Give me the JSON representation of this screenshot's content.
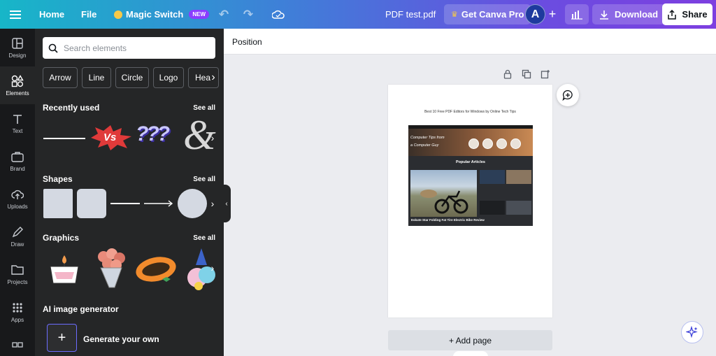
{
  "topbar": {
    "home": "Home",
    "file": "File",
    "magic_switch": "Magic Switch",
    "new_badge": "NEW",
    "doc_name": "PDF test.pdf",
    "get_pro": "Get Canva Pro",
    "avatar_initial": "A",
    "download": "Download",
    "share": "Share"
  },
  "rail": {
    "items": [
      {
        "label": "Design",
        "icon": "layout-icon"
      },
      {
        "label": "Elements",
        "icon": "shapes-icon"
      },
      {
        "label": "Text",
        "icon": "text-icon"
      },
      {
        "label": "Brand",
        "icon": "brand-icon"
      },
      {
        "label": "Uploads",
        "icon": "upload-icon"
      },
      {
        "label": "Draw",
        "icon": "draw-icon"
      },
      {
        "label": "Projects",
        "icon": "folder-icon"
      },
      {
        "label": "Apps",
        "icon": "apps-icon"
      }
    ],
    "active": "Elements"
  },
  "panel": {
    "search_placeholder": "Search elements",
    "chips": [
      "Arrow",
      "Line",
      "Circle",
      "Logo",
      "Hea"
    ],
    "recently_used": {
      "title": "Recently used",
      "see_all": "See all"
    },
    "shapes": {
      "title": "Shapes",
      "see_all": "See all"
    },
    "graphics": {
      "title": "Graphics",
      "see_all": "See all"
    },
    "ai": {
      "title": "AI image generator",
      "generate": "Generate your own"
    },
    "recent_text": {
      "vs": "Vs",
      "questions": "???",
      "amp": "&"
    }
  },
  "canvas": {
    "position_label": "Position",
    "page_caption": "Best 10 Free PDF Editors for Windows by Online Tech Tips",
    "shot": {
      "hero_line1": "Computer Tips from",
      "hero_line2": "a Computer Guy",
      "popular": "Popular Articles",
      "main_caption": "Eskute Star Folding Fat Tire Electric Bike Review"
    },
    "add_page": "+ Add page"
  },
  "colors": {
    "panel_bg": "#252627",
    "rail_bg": "#18191b",
    "accent_purple": "#8b3dff",
    "canvas_bg": "#ebecf0"
  }
}
